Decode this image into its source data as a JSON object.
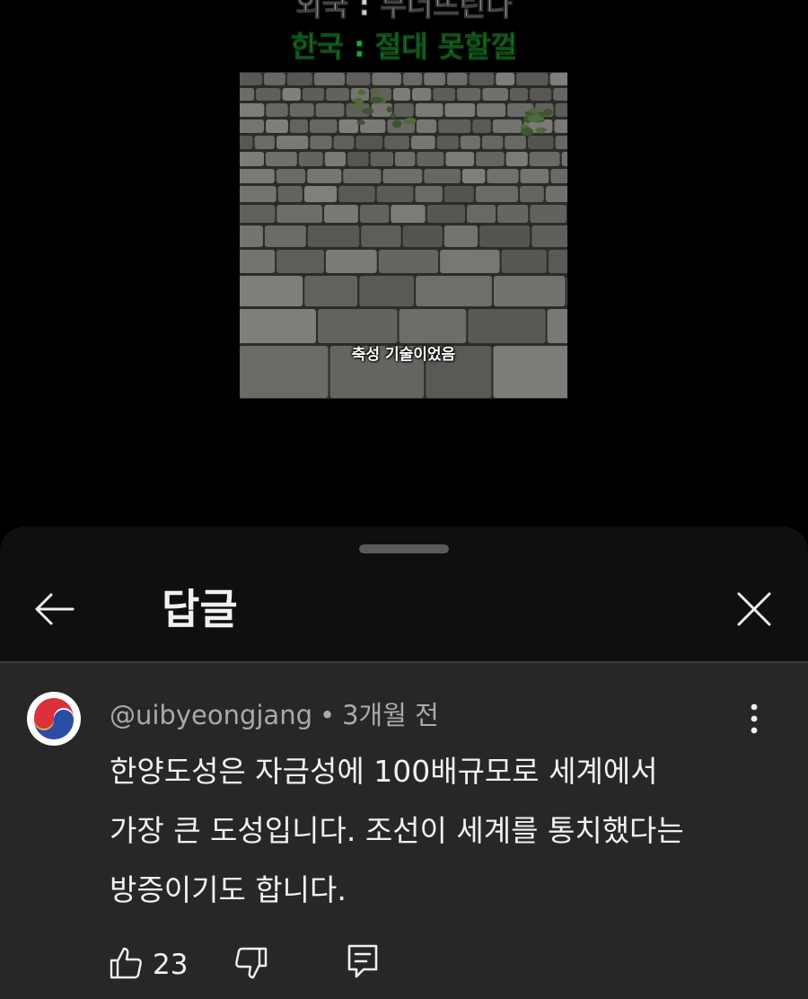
{
  "video": {
    "caption_foreign": "외국 : 무너뜨린다",
    "caption_korea": "한국 : 절대 못할껄",
    "subtitle": "축성 기술이었음"
  },
  "sheet": {
    "title": "답글"
  },
  "icons": {
    "back": "arrow-left-icon",
    "close": "close-icon",
    "more": "more-vertical-icon",
    "like": "thumbs-up-icon",
    "dislike": "thumbs-down-icon",
    "reply": "reply-comment-icon",
    "avatar": "taegeuk-avatar-icon"
  },
  "comment": {
    "author": "@uibyeongjang",
    "separator": "•",
    "time": "3개월 전",
    "lines": [
      "한양도성은 자금성에 100배규모로 세계에서",
      "가장 큰 도성입니다. 조선이 세계를 통치했다는",
      "방증이기도 합니다."
    ],
    "likes": "23"
  },
  "colors": {
    "background": "#000000",
    "sheet": "#0f0f0f",
    "card": "#272727",
    "caption_green": "#22a83a",
    "text_primary": "#f1f1f1",
    "text_secondary": "#aaaaaa"
  }
}
